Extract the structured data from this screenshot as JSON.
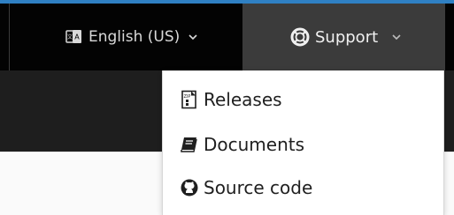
{
  "navbar": {
    "language_label": "English (US)",
    "support_label": "Support"
  },
  "support_dropdown": {
    "items": [
      {
        "label": "Releases",
        "icon": "releases-icon"
      },
      {
        "label": "Documents",
        "icon": "book-icon"
      },
      {
        "label": "Source code",
        "icon": "github-icon"
      }
    ]
  },
  "colors": {
    "accent": "#2f80c3",
    "navbar_bg": "#030303",
    "support_bg": "#3b3b3b"
  }
}
